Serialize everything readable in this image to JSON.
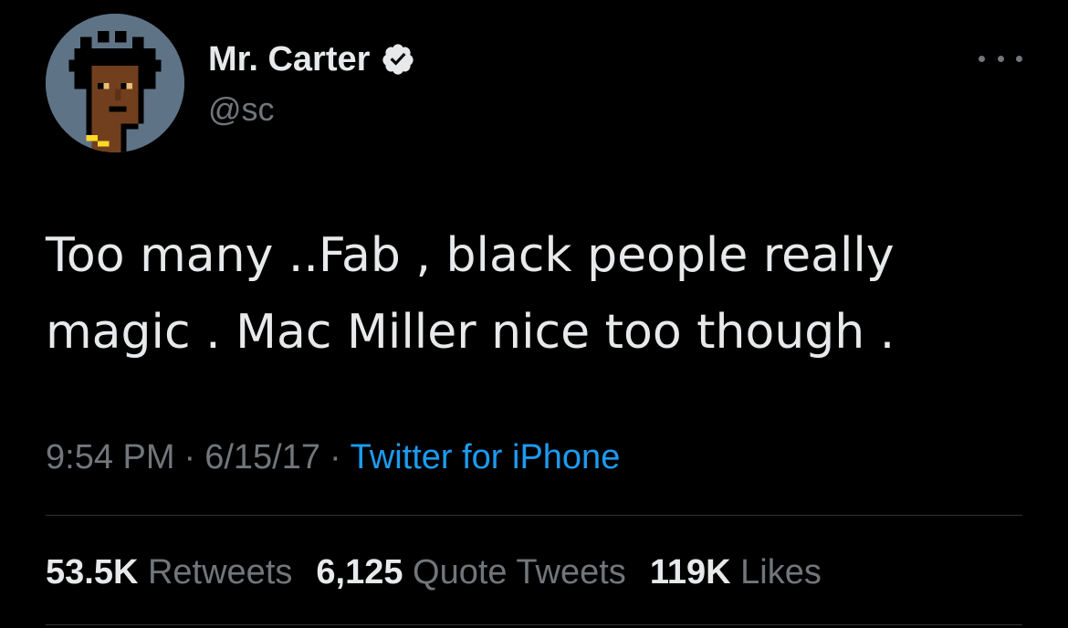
{
  "user": {
    "display_name": "Mr. Carter",
    "handle": "@sc",
    "verified": true
  },
  "tweet": {
    "text": "Too many ..Fab , black people really magic . Mac Miller nice too though ."
  },
  "meta": {
    "time": "9:54 PM",
    "separator": "·",
    "date": "6/15/17",
    "source": "Twitter for iPhone"
  },
  "stats": {
    "retweets_count": "53.5K",
    "retweets_label": "Retweets",
    "quotes_count": "6,125",
    "quotes_label": "Quote Tweets",
    "likes_count": "119K",
    "likes_label": "Likes"
  },
  "colors": {
    "background": "#000000",
    "text_primary": "#e7e9ea",
    "text_secondary": "#71767b",
    "link": "#1d9bf0",
    "avatar_bg": "#5f7386",
    "divider": "#2f3336"
  },
  "icons": {
    "verified": "verified-badge-icon",
    "more": "more-options-icon"
  }
}
